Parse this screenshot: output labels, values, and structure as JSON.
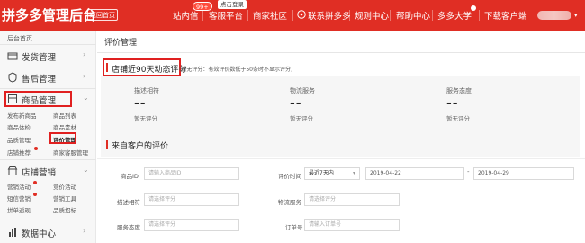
{
  "header": {
    "brand": "拼多多管理后台",
    "back_home": "返回首页",
    "nav": [
      "站内信",
      "客服平台",
      "商家社区",
      "联系拼多多",
      "规则中心",
      "帮助中心",
      "多多大学",
      "下载客户端"
    ],
    "badge_count": "99+",
    "login_tag": "点击登录",
    "accent_color": "#e02e24"
  },
  "sidebar": {
    "home": "后台首页",
    "sections": [
      {
        "label": "发货管理",
        "icon": "truck-icon"
      },
      {
        "label": "售后管理",
        "icon": "after-sale-icon"
      },
      {
        "label": "商品管理",
        "icon": "goods-icon"
      },
      {
        "label": "店铺营销",
        "icon": "shop-icon"
      },
      {
        "label": "数据中心",
        "icon": "data-icon"
      }
    ],
    "goods_items": [
      "发布新商品",
      "商品列表",
      "商品体检",
      "商品素材",
      "品质管理",
      "评价管理",
      "店铺推荐",
      "商家客服管理"
    ],
    "marketing_items": [
      "营销活动",
      "竞价活动",
      "短信营销",
      "营销工具",
      "拼单返现",
      "品质招标"
    ]
  },
  "main": {
    "page_title": "评价管理",
    "stats_title": "店铺近90天动态评分",
    "stats_note": "(暂无评分：有效评价数低于50条时不显示评分)",
    "metrics": [
      {
        "label": "描述相符",
        "value": "--",
        "sub": "暂无评分"
      },
      {
        "label": "物流服务",
        "value": "--",
        "sub": "暂无评分"
      },
      {
        "label": "服务态度",
        "value": "--",
        "sub": "暂无评分"
      }
    ],
    "reviews_title": "来自客户的评价",
    "filters": {
      "goods_id_label": "商品ID",
      "goods_id_placeholder": "请输入商品ID",
      "time_label": "评价时间",
      "time_range": "最近7天内",
      "date_start": "2019-04-22",
      "date_end": "2019-04-29",
      "desc_label": "描述相符",
      "desc_placeholder": "请选择评分",
      "logistics_label": "物流服务",
      "logistics_placeholder": "请选择评分",
      "service_label": "服务态度",
      "service_placeholder": "请选择评分",
      "order_label": "订单号",
      "order_placeholder": "请输入订单号"
    }
  }
}
